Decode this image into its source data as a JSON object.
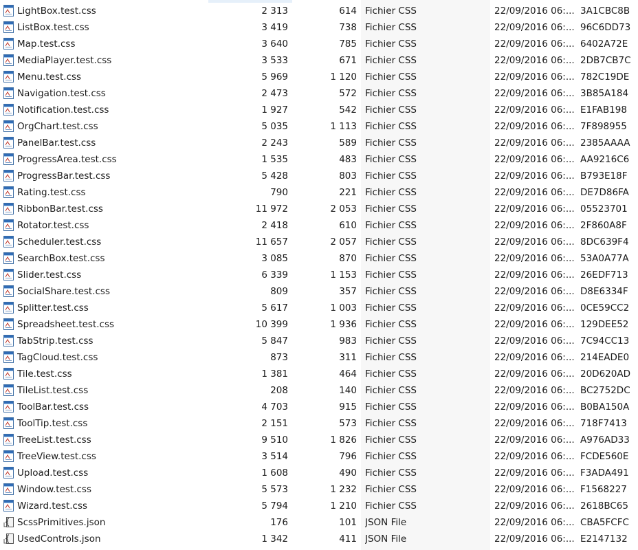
{
  "files": [
    {
      "name": "LightBox.test.css",
      "size": "2 313",
      "compressed": "614",
      "type": "Fichier CSS",
      "modified": "22/09/2016 06:...",
      "crc": "3A1CBC8B",
      "icon": "css-file-icon"
    },
    {
      "name": "ListBox.test.css",
      "size": "3 419",
      "compressed": "738",
      "type": "Fichier CSS",
      "modified": "22/09/2016 06:...",
      "crc": "96C6DD73",
      "icon": "css-file-icon"
    },
    {
      "name": "Map.test.css",
      "size": "3 640",
      "compressed": "785",
      "type": "Fichier CSS",
      "modified": "22/09/2016 06:...",
      "crc": "6402A72E",
      "icon": "css-file-icon"
    },
    {
      "name": "MediaPlayer.test.css",
      "size": "3 533",
      "compressed": "671",
      "type": "Fichier CSS",
      "modified": "22/09/2016 06:...",
      "crc": "2DB7CB7C",
      "icon": "css-file-icon"
    },
    {
      "name": "Menu.test.css",
      "size": "5 969",
      "compressed": "1 120",
      "type": "Fichier CSS",
      "modified": "22/09/2016 06:...",
      "crc": "782C19DE",
      "icon": "css-file-icon"
    },
    {
      "name": "Navigation.test.css",
      "size": "2 473",
      "compressed": "572",
      "type": "Fichier CSS",
      "modified": "22/09/2016 06:...",
      "crc": "3B85A184",
      "icon": "css-file-icon"
    },
    {
      "name": "Notification.test.css",
      "size": "1 927",
      "compressed": "542",
      "type": "Fichier CSS",
      "modified": "22/09/2016 06:...",
      "crc": "E1FAB198",
      "icon": "css-file-icon"
    },
    {
      "name": "OrgChart.test.css",
      "size": "5 035",
      "compressed": "1 113",
      "type": "Fichier CSS",
      "modified": "22/09/2016 06:...",
      "crc": "7F898955",
      "icon": "css-file-icon"
    },
    {
      "name": "PanelBar.test.css",
      "size": "2 243",
      "compressed": "589",
      "type": "Fichier CSS",
      "modified": "22/09/2016 06:...",
      "crc": "2385AAAA",
      "icon": "css-file-icon"
    },
    {
      "name": "ProgressArea.test.css",
      "size": "1 535",
      "compressed": "483",
      "type": "Fichier CSS",
      "modified": "22/09/2016 06:...",
      "crc": "AA9216C6",
      "icon": "css-file-icon"
    },
    {
      "name": "ProgressBar.test.css",
      "size": "5 428",
      "compressed": "803",
      "type": "Fichier CSS",
      "modified": "22/09/2016 06:...",
      "crc": "B793E18F",
      "icon": "css-file-icon"
    },
    {
      "name": "Rating.test.css",
      "size": "790",
      "compressed": "221",
      "type": "Fichier CSS",
      "modified": "22/09/2016 06:...",
      "crc": "DE7D86FA",
      "icon": "css-file-icon"
    },
    {
      "name": "RibbonBar.test.css",
      "size": "11 972",
      "compressed": "2 053",
      "type": "Fichier CSS",
      "modified": "22/09/2016 06:...",
      "crc": "05523701",
      "icon": "css-file-icon"
    },
    {
      "name": "Rotator.test.css",
      "size": "2 418",
      "compressed": "610",
      "type": "Fichier CSS",
      "modified": "22/09/2016 06:...",
      "crc": "2F860A8F",
      "icon": "css-file-icon"
    },
    {
      "name": "Scheduler.test.css",
      "size": "11 657",
      "compressed": "2 057",
      "type": "Fichier CSS",
      "modified": "22/09/2016 06:...",
      "crc": "8DC639F4",
      "icon": "css-file-icon"
    },
    {
      "name": "SearchBox.test.css",
      "size": "3 085",
      "compressed": "870",
      "type": "Fichier CSS",
      "modified": "22/09/2016 06:...",
      "crc": "53A0A77A",
      "icon": "css-file-icon"
    },
    {
      "name": "Slider.test.css",
      "size": "6 339",
      "compressed": "1 153",
      "type": "Fichier CSS",
      "modified": "22/09/2016 06:...",
      "crc": "26EDF713",
      "icon": "css-file-icon"
    },
    {
      "name": "SocialShare.test.css",
      "size": "809",
      "compressed": "357",
      "type": "Fichier CSS",
      "modified": "22/09/2016 06:...",
      "crc": "D8E6334F",
      "icon": "css-file-icon"
    },
    {
      "name": "Splitter.test.css",
      "size": "5 617",
      "compressed": "1 003",
      "type": "Fichier CSS",
      "modified": "22/09/2016 06:...",
      "crc": "0CE59CC2",
      "icon": "css-file-icon"
    },
    {
      "name": "Spreadsheet.test.css",
      "size": "10 399",
      "compressed": "1 936",
      "type": "Fichier CSS",
      "modified": "22/09/2016 06:...",
      "crc": "129DEE52",
      "icon": "css-file-icon"
    },
    {
      "name": "TabStrip.test.css",
      "size": "5 847",
      "compressed": "983",
      "type": "Fichier CSS",
      "modified": "22/09/2016 06:...",
      "crc": "7C94CC13",
      "icon": "css-file-icon"
    },
    {
      "name": "TagCloud.test.css",
      "size": "873",
      "compressed": "311",
      "type": "Fichier CSS",
      "modified": "22/09/2016 06:...",
      "crc": "214EADE0",
      "icon": "css-file-icon"
    },
    {
      "name": "Tile.test.css",
      "size": "1 381",
      "compressed": "464",
      "type": "Fichier CSS",
      "modified": "22/09/2016 06:...",
      "crc": "20D620AD",
      "icon": "css-file-icon"
    },
    {
      "name": "TileList.test.css",
      "size": "208",
      "compressed": "140",
      "type": "Fichier CSS",
      "modified": "22/09/2016 06:...",
      "crc": "BC2752DC",
      "icon": "css-file-icon"
    },
    {
      "name": "ToolBar.test.css",
      "size": "4 703",
      "compressed": "915",
      "type": "Fichier CSS",
      "modified": "22/09/2016 06:...",
      "crc": "B0BA150A",
      "icon": "css-file-icon"
    },
    {
      "name": "ToolTip.test.css",
      "size": "2 151",
      "compressed": "573",
      "type": "Fichier CSS",
      "modified": "22/09/2016 06:...",
      "crc": "718F7413",
      "icon": "css-file-icon"
    },
    {
      "name": "TreeList.test.css",
      "size": "9 510",
      "compressed": "1 826",
      "type": "Fichier CSS",
      "modified": "22/09/2016 06:...",
      "crc": "A976AD33",
      "icon": "css-file-icon"
    },
    {
      "name": "TreeView.test.css",
      "size": "3 514",
      "compressed": "796",
      "type": "Fichier CSS",
      "modified": "22/09/2016 06:...",
      "crc": "FCDE560E",
      "icon": "css-file-icon"
    },
    {
      "name": "Upload.test.css",
      "size": "1 608",
      "compressed": "490",
      "type": "Fichier CSS",
      "modified": "22/09/2016 06:...",
      "crc": "F3ADA491",
      "icon": "css-file-icon"
    },
    {
      "name": "Window.test.css",
      "size": "5 573",
      "compressed": "1 232",
      "type": "Fichier CSS",
      "modified": "22/09/2016 06:...",
      "crc": "F1568227",
      "icon": "css-file-icon"
    },
    {
      "name": "Wizard.test.css",
      "size": "5 794",
      "compressed": "1 210",
      "type": "Fichier CSS",
      "modified": "22/09/2016 06:...",
      "crc": "2618BC65",
      "icon": "css-file-icon"
    },
    {
      "name": "ScssPrimitives.json",
      "size": "176",
      "compressed": "101",
      "type": "JSON File",
      "modified": "22/09/2016 06:...",
      "crc": "CBA5FCFC",
      "icon": "json-file-icon"
    },
    {
      "name": "UsedControls.json",
      "size": "1 342",
      "compressed": "411",
      "type": "JSON File",
      "modified": "22/09/2016 06:...",
      "crc": "E2147132",
      "icon": "json-file-icon"
    }
  ]
}
